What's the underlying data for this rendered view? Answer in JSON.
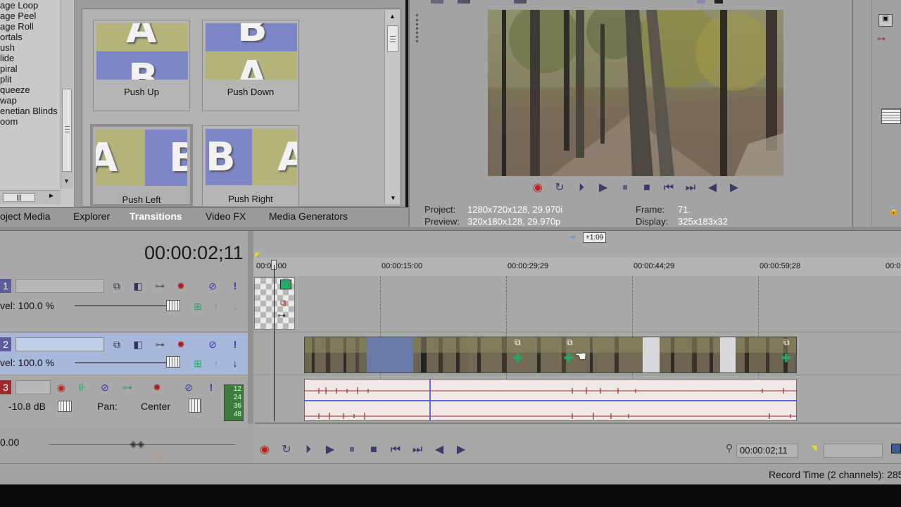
{
  "transition_list": {
    "items": [
      {
        "label": "age Loop"
      },
      {
        "label": "age Peel"
      },
      {
        "label": "age Roll"
      },
      {
        "label": "ortals"
      },
      {
        "label": "ush"
      },
      {
        "label": "lide"
      },
      {
        "label": "piral"
      },
      {
        "label": "plit"
      },
      {
        "label": "queeze"
      },
      {
        "label": "wap"
      },
      {
        "label": "enetian Blinds"
      },
      {
        "label": "oom"
      }
    ],
    "selected": "ush"
  },
  "thumbnails": [
    {
      "label": "Push Up"
    },
    {
      "label": "Push Down"
    },
    {
      "label": "Push Left"
    },
    {
      "label": "Push Right"
    }
  ],
  "window_tabs": [
    {
      "label": "oject Media"
    },
    {
      "label": "Explorer"
    },
    {
      "label": "Transitions"
    },
    {
      "label": "Video FX"
    },
    {
      "label": "Media Generators"
    }
  ],
  "active_tab": "Transitions",
  "preview": {
    "project_label": "Project:",
    "project_value": "1280x720x128, 29.970i",
    "preview_label": "Preview:",
    "preview_value": "320x180x128, 29.970p",
    "frame_label": "Frame:",
    "frame_value": "71.",
    "display_label": "Display:",
    "display_value": "325x183x32"
  },
  "timecode": "00:00:02;11",
  "region_badge": "+1:09",
  "ruler": {
    "labels": [
      "00:00:00",
      "00:00:15:00",
      "00:00:29;29",
      "00:00:44;29",
      "00:00:59;28",
      "00:0"
    ]
  },
  "tracks": [
    {
      "number": "1",
      "level_text": "vel: 100.0 %"
    },
    {
      "number": "2",
      "level_text": "vel: 100.0 %"
    },
    {
      "number": "3",
      "volume": "-10.8 dB",
      "pan_label": "Pan:",
      "pan_value": "Center"
    }
  ],
  "meter_labels": [
    "12",
    "24",
    "36",
    "48"
  ],
  "bottom_left_value": "0.00",
  "transport_timecode": "00:00:02;11",
  "status_text": "Record Time (2 channels): 285",
  "colors": {
    "accent_video": "#5d5d9d",
    "accent_audio": "#9b2a2a",
    "selected_track": "#a8b8da"
  }
}
